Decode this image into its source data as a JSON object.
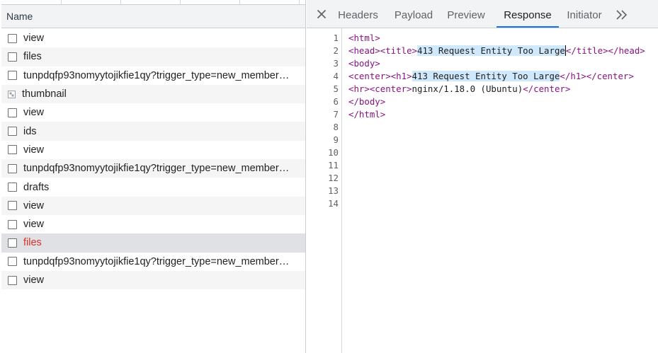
{
  "request_list": {
    "header": "Name",
    "rows": [
      {
        "name": "view",
        "icon": "checkbox",
        "state": "normal"
      },
      {
        "name": "files",
        "icon": "checkbox",
        "state": "normal"
      },
      {
        "name": "tunpdqfp93nomyytojikfie1qy?trigger_type=new_member…",
        "icon": "checkbox",
        "state": "normal"
      },
      {
        "name": "thumbnail",
        "icon": "image-icon",
        "state": "normal"
      },
      {
        "name": "view",
        "icon": "checkbox",
        "state": "normal"
      },
      {
        "name": "ids",
        "icon": "checkbox",
        "state": "normal"
      },
      {
        "name": "view",
        "icon": "checkbox",
        "state": "normal"
      },
      {
        "name": "tunpdqfp93nomyytojikfie1qy?trigger_type=new_member…",
        "icon": "checkbox",
        "state": "normal"
      },
      {
        "name": "drafts",
        "icon": "checkbox",
        "state": "normal"
      },
      {
        "name": "view",
        "icon": "checkbox",
        "state": "normal"
      },
      {
        "name": "view",
        "icon": "checkbox",
        "state": "normal"
      },
      {
        "name": "files",
        "icon": "checkbox",
        "state": "selected-error"
      },
      {
        "name": "tunpdqfp93nomyytojikfie1qy?trigger_type=new_member…",
        "icon": "checkbox",
        "state": "normal"
      },
      {
        "name": "view",
        "icon": "checkbox",
        "state": "normal"
      }
    ]
  },
  "detail_tabs": {
    "items": [
      "Headers",
      "Payload",
      "Preview",
      "Response",
      "Initiator"
    ],
    "active": "Response",
    "close_icon": "close-icon",
    "more_icon": "chevron-double-right-icon"
  },
  "response": {
    "line_numbers": [
      "1",
      "2",
      "3",
      "4",
      "5",
      "6",
      "7",
      "8",
      "9",
      "10",
      "11",
      "12",
      "13",
      "14"
    ],
    "lines": [
      "<html>",
      "<head><title>413 Request Entity Too Large</title></head>",
      "<body>",
      "<center><h1>413 Request Entity Too Large</h1></center>",
      "<hr><center>nginx/1.18.0 (Ubuntu)</center>",
      "</body>",
      "</html>",
      "",
      "",
      "",
      "",
      "",
      "",
      ""
    ],
    "highlight_text": "413 Request Entity Too Large"
  },
  "colors": {
    "accent": "#1a73e8",
    "tag": "#881280",
    "error_text": "#d93025",
    "selection_highlight": "#cfe8fc"
  }
}
